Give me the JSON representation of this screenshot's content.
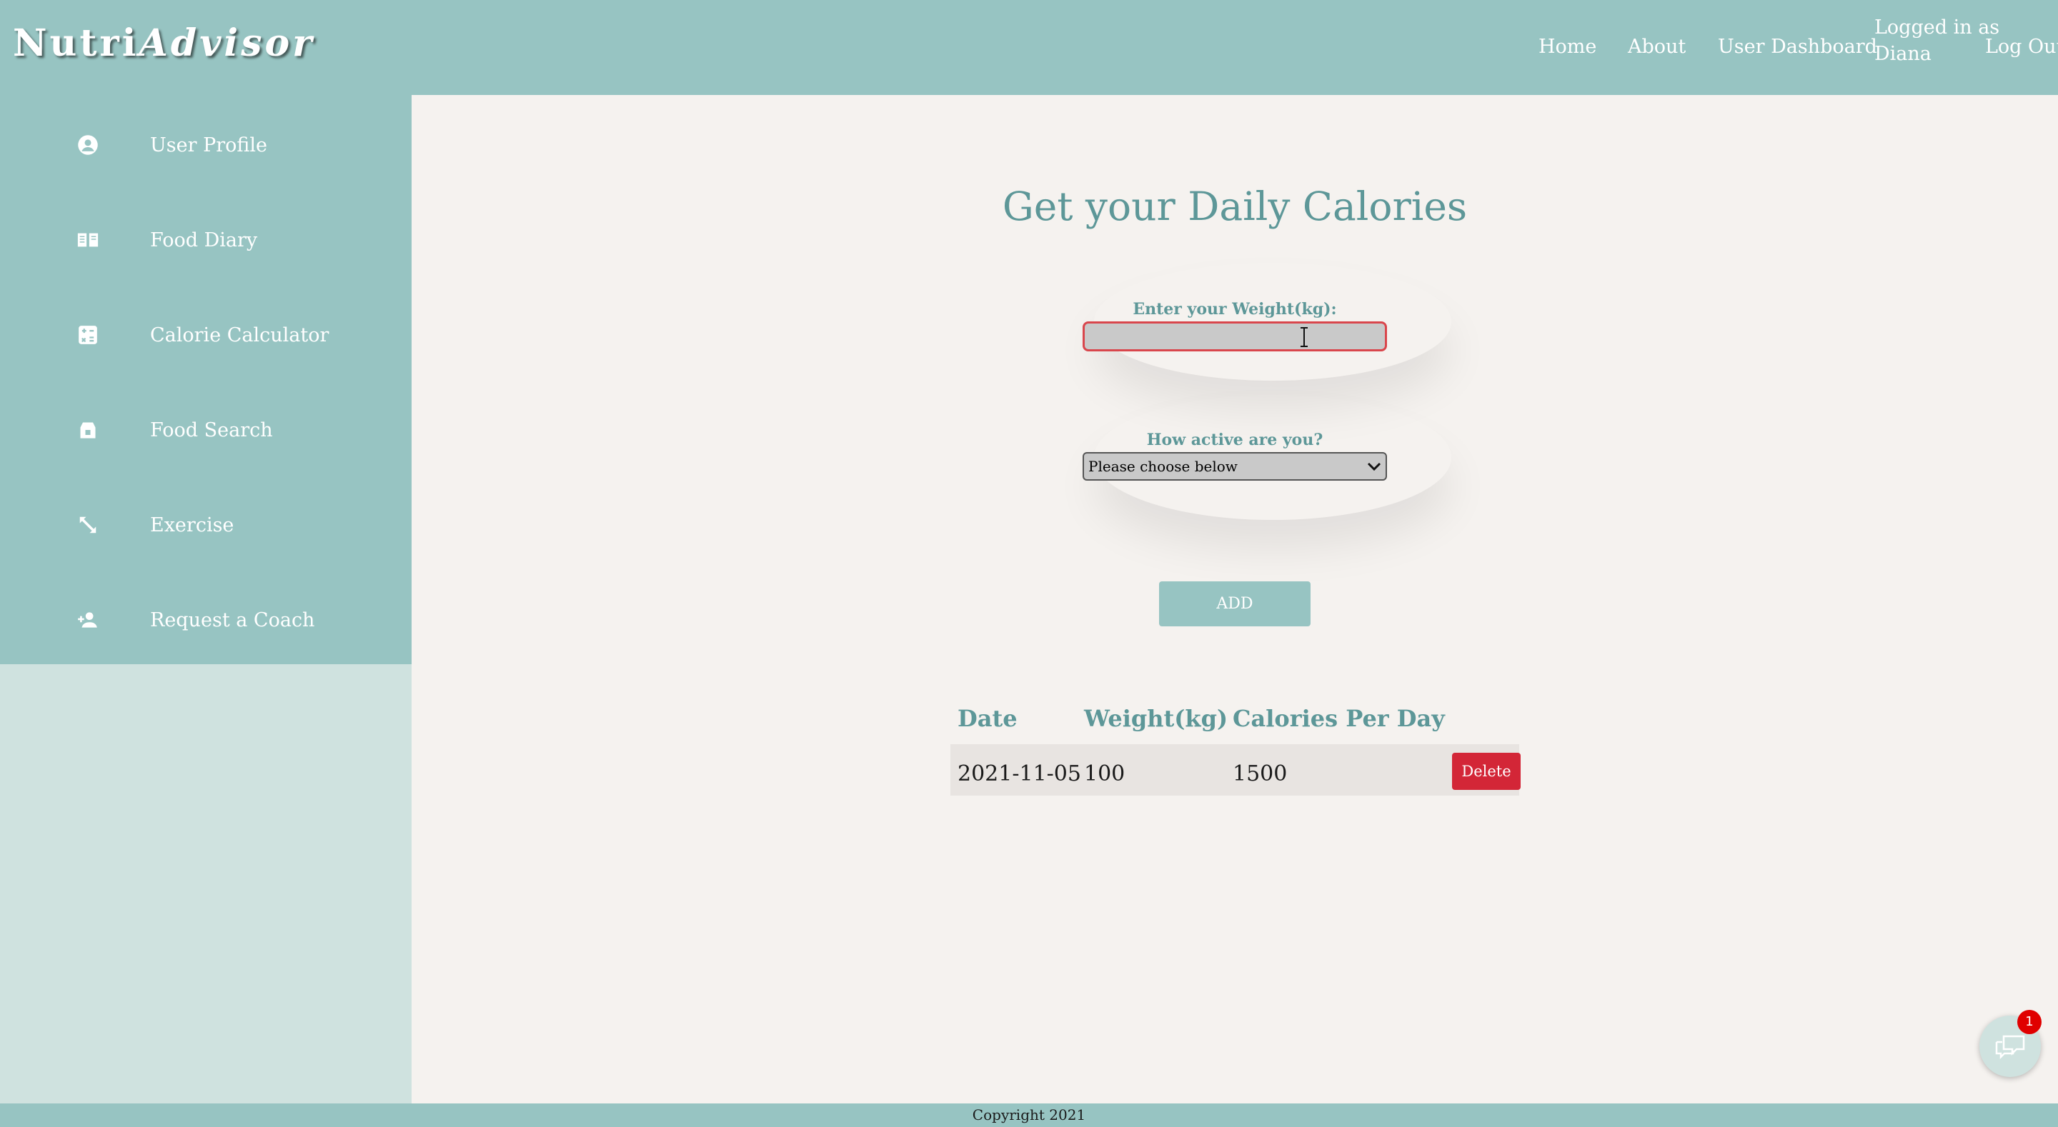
{
  "header": {
    "logo_part1": "Nutri",
    "logo_part2": "Advisor",
    "nav": {
      "home": "Home",
      "about": "About",
      "dashboard": "User Dashboard",
      "logged_in": "Logged in as Diana",
      "logout": "Log Out"
    }
  },
  "sidebar": {
    "items": [
      {
        "label": "User Profile",
        "icon": "user-circle-icon"
      },
      {
        "label": "Food Diary",
        "icon": "book-icon"
      },
      {
        "label": "Calorie Calculator",
        "icon": "calculator-icon"
      },
      {
        "label": "Food Search",
        "icon": "store-icon"
      },
      {
        "label": "Exercise",
        "icon": "expand-arrows-icon"
      },
      {
        "label": "Request a Coach",
        "icon": "user-plus-icon"
      }
    ]
  },
  "main": {
    "title": "Get your Daily Calories",
    "weight_label": "Enter your Weight(kg):",
    "weight_value": "",
    "activity_label": "How active are you?",
    "activity_selected": "Please choose below",
    "add_button": "ADD"
  },
  "table": {
    "headers": [
      "Date",
      "Weight(kg)",
      "Calories Per Day"
    ],
    "rows": [
      {
        "date": "2021-11-05",
        "weight": "100",
        "calories": "1500",
        "action": "Delete"
      }
    ]
  },
  "footer": {
    "text": "Copyright 2021"
  },
  "chat": {
    "badge": "1"
  },
  "colors": {
    "teal": "#97c4c2",
    "teal_dark_text": "#5d9798",
    "background": "#f5f2ef",
    "delete_red": "#d32637",
    "input_border_red": "#d9464c"
  }
}
